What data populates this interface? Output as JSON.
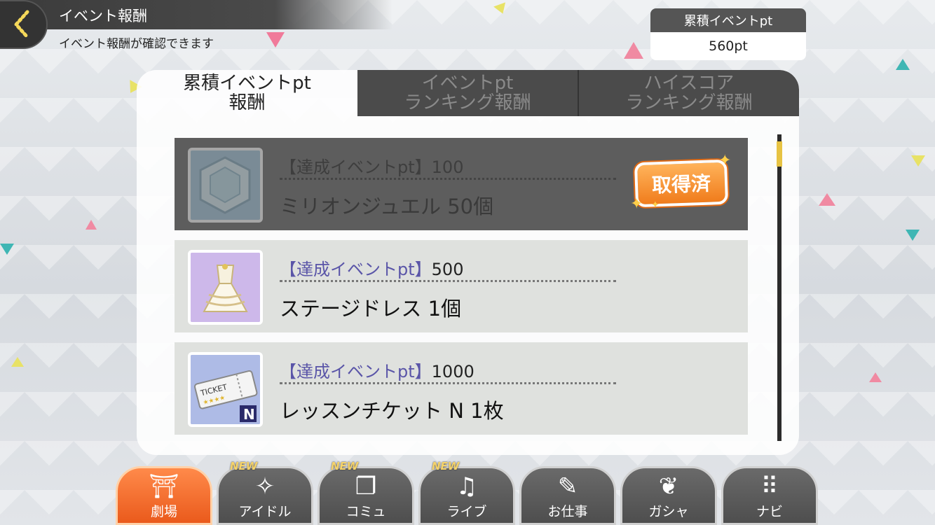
{
  "header": {
    "title": "イベント報酬",
    "subtitle": "イベント報酬が確認できます"
  },
  "points": {
    "label": "累積イベントpt",
    "value": "560pt"
  },
  "tabs": [
    {
      "line1": "累積イベントpt",
      "line2": "報酬",
      "active": true
    },
    {
      "line1": "イベントpt",
      "line2": "ランキング報酬",
      "active": false
    },
    {
      "line1": "ハイスコア",
      "line2": "ランキング報酬",
      "active": false
    }
  ],
  "rewards": [
    {
      "requirement_label": "【達成イベントpt】",
      "requirement_value": "100",
      "name": "ミリオンジュエル 50個",
      "icon": "million-jewel-icon",
      "claimed": true,
      "stamp": "取得済"
    },
    {
      "requirement_label": "【達成イベントpt】",
      "requirement_value": "500",
      "name": "ステージドレス 1個",
      "icon": "stage-dress-icon",
      "claimed": false
    },
    {
      "requirement_label": "【達成イベントpt】",
      "requirement_value": "1000",
      "name": "レッスンチケット N 1枚",
      "icon": "lesson-ticket-icon",
      "claimed": false
    }
  ],
  "ticket": {
    "text": "TICKET",
    "grade": "N"
  },
  "nav": [
    {
      "label": "劇場",
      "icon": "theater-icon",
      "active": true,
      "new": false
    },
    {
      "label": "アイドル",
      "icon": "idol-icon",
      "active": false,
      "new": true
    },
    {
      "label": "コミュ",
      "icon": "commu-icon",
      "active": false,
      "new": true
    },
    {
      "label": "ライブ",
      "icon": "live-icon",
      "active": false,
      "new": true
    },
    {
      "label": "お仕事",
      "icon": "work-icon",
      "active": false,
      "new": false
    },
    {
      "label": "ガシャ",
      "icon": "gacha-icon",
      "active": false,
      "new": false
    },
    {
      "label": "ナビ",
      "icon": "navi-icon",
      "active": false,
      "new": false
    }
  ],
  "new_badge": "NEW",
  "colors": {
    "active_tab_orange": "#ea5a1c",
    "requirement_purple": "#5a55a8",
    "stamp_orange": "#f07c1c",
    "scroll_thumb": "#e7c343"
  }
}
